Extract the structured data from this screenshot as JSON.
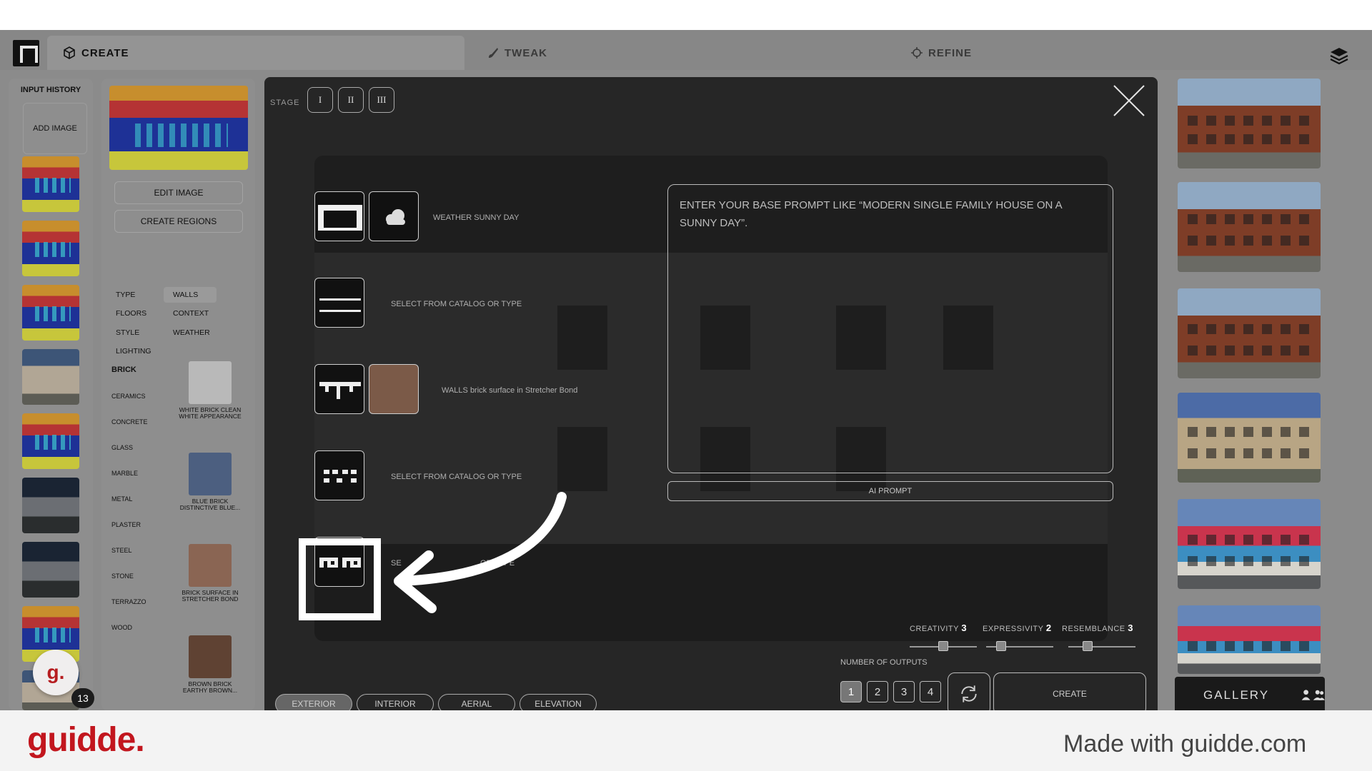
{
  "tabs": [
    {
      "label": "CREATE",
      "icon": "create-cube-icon"
    },
    {
      "label": "TWEAK",
      "icon": "brush-icon"
    },
    {
      "label": "REFINE",
      "icon": "crosshair-icon"
    }
  ],
  "history": {
    "title": "INPUT HISTORY",
    "add_label": "ADD IMAGE",
    "avatar_letter": "g.",
    "badge_count": "13"
  },
  "panel2": {
    "edit_label": "EDIT IMAGE",
    "regions_label": "CREATE REGIONS",
    "categories": [
      "TYPE",
      "WALLS",
      "FLOORS",
      "CONTEXT",
      "STYLE",
      "WEATHER",
      "LIGHTING"
    ],
    "materials": [
      "BRICK",
      "CERAMICS",
      "CONCRETE",
      "GLASS",
      "MARBLE",
      "METAL",
      "PLASTER",
      "STEEL",
      "STONE",
      "TERRAZZO",
      "WOOD"
    ],
    "swatches": [
      {
        "line1": "WHITE BRICK CLEAN",
        "line2": "WHITE APPEARANCE",
        "color": "#b9b9b9"
      },
      {
        "line1": "BLUE BRICK",
        "line2": "DISTINCTIVE BLUE...",
        "color": "#4c5f80"
      },
      {
        "line1": "BRICK SURFACE IN",
        "line2": "STRETCHER BOND",
        "color": "#8a6553"
      },
      {
        "line1": "BROWN BRICK",
        "line2": "EARTHY BROWN...",
        "color": "#5f4233"
      }
    ]
  },
  "modal": {
    "stage_label": "STAGE",
    "stages": [
      "I",
      "II",
      "III"
    ],
    "rows": [
      "WEATHER SUNNY DAY",
      "SELECT FROM CATALOG OR TYPE",
      "WALLS brick surface in Stretcher Bond",
      "SELECT FROM CATALOG OR TYPE",
      "SE",
      "OR TYPE"
    ],
    "prompt_placeholder": "ENTER YOUR BASE PROMPT LIKE “MODERN SINGLE FAMILY HOUSE ON A SUNNY DAY”.",
    "ai_prompt_label": "AI PROMPT",
    "sliders": [
      {
        "label": "CREATIVITY",
        "value": "3"
      },
      {
        "label": "EXPRESSIVITY",
        "value": "2"
      },
      {
        "label": "RESEMBLANCE",
        "value": "3"
      }
    ],
    "number_of_outputs_label": "NUMBER OF OUTPUTS",
    "outputs": [
      "1",
      "2",
      "3",
      "4"
    ],
    "selected_output": "1",
    "create_label": "CREATE",
    "views": [
      "EXTERIOR",
      "INTERIOR",
      "AERIAL",
      "ELEVATION"
    ],
    "selected_view": "EXTERIOR"
  },
  "gallery": {
    "label": "GALLERY"
  },
  "footer": {
    "brand": "guidde.",
    "made_with": "Made with guidde.com"
  }
}
